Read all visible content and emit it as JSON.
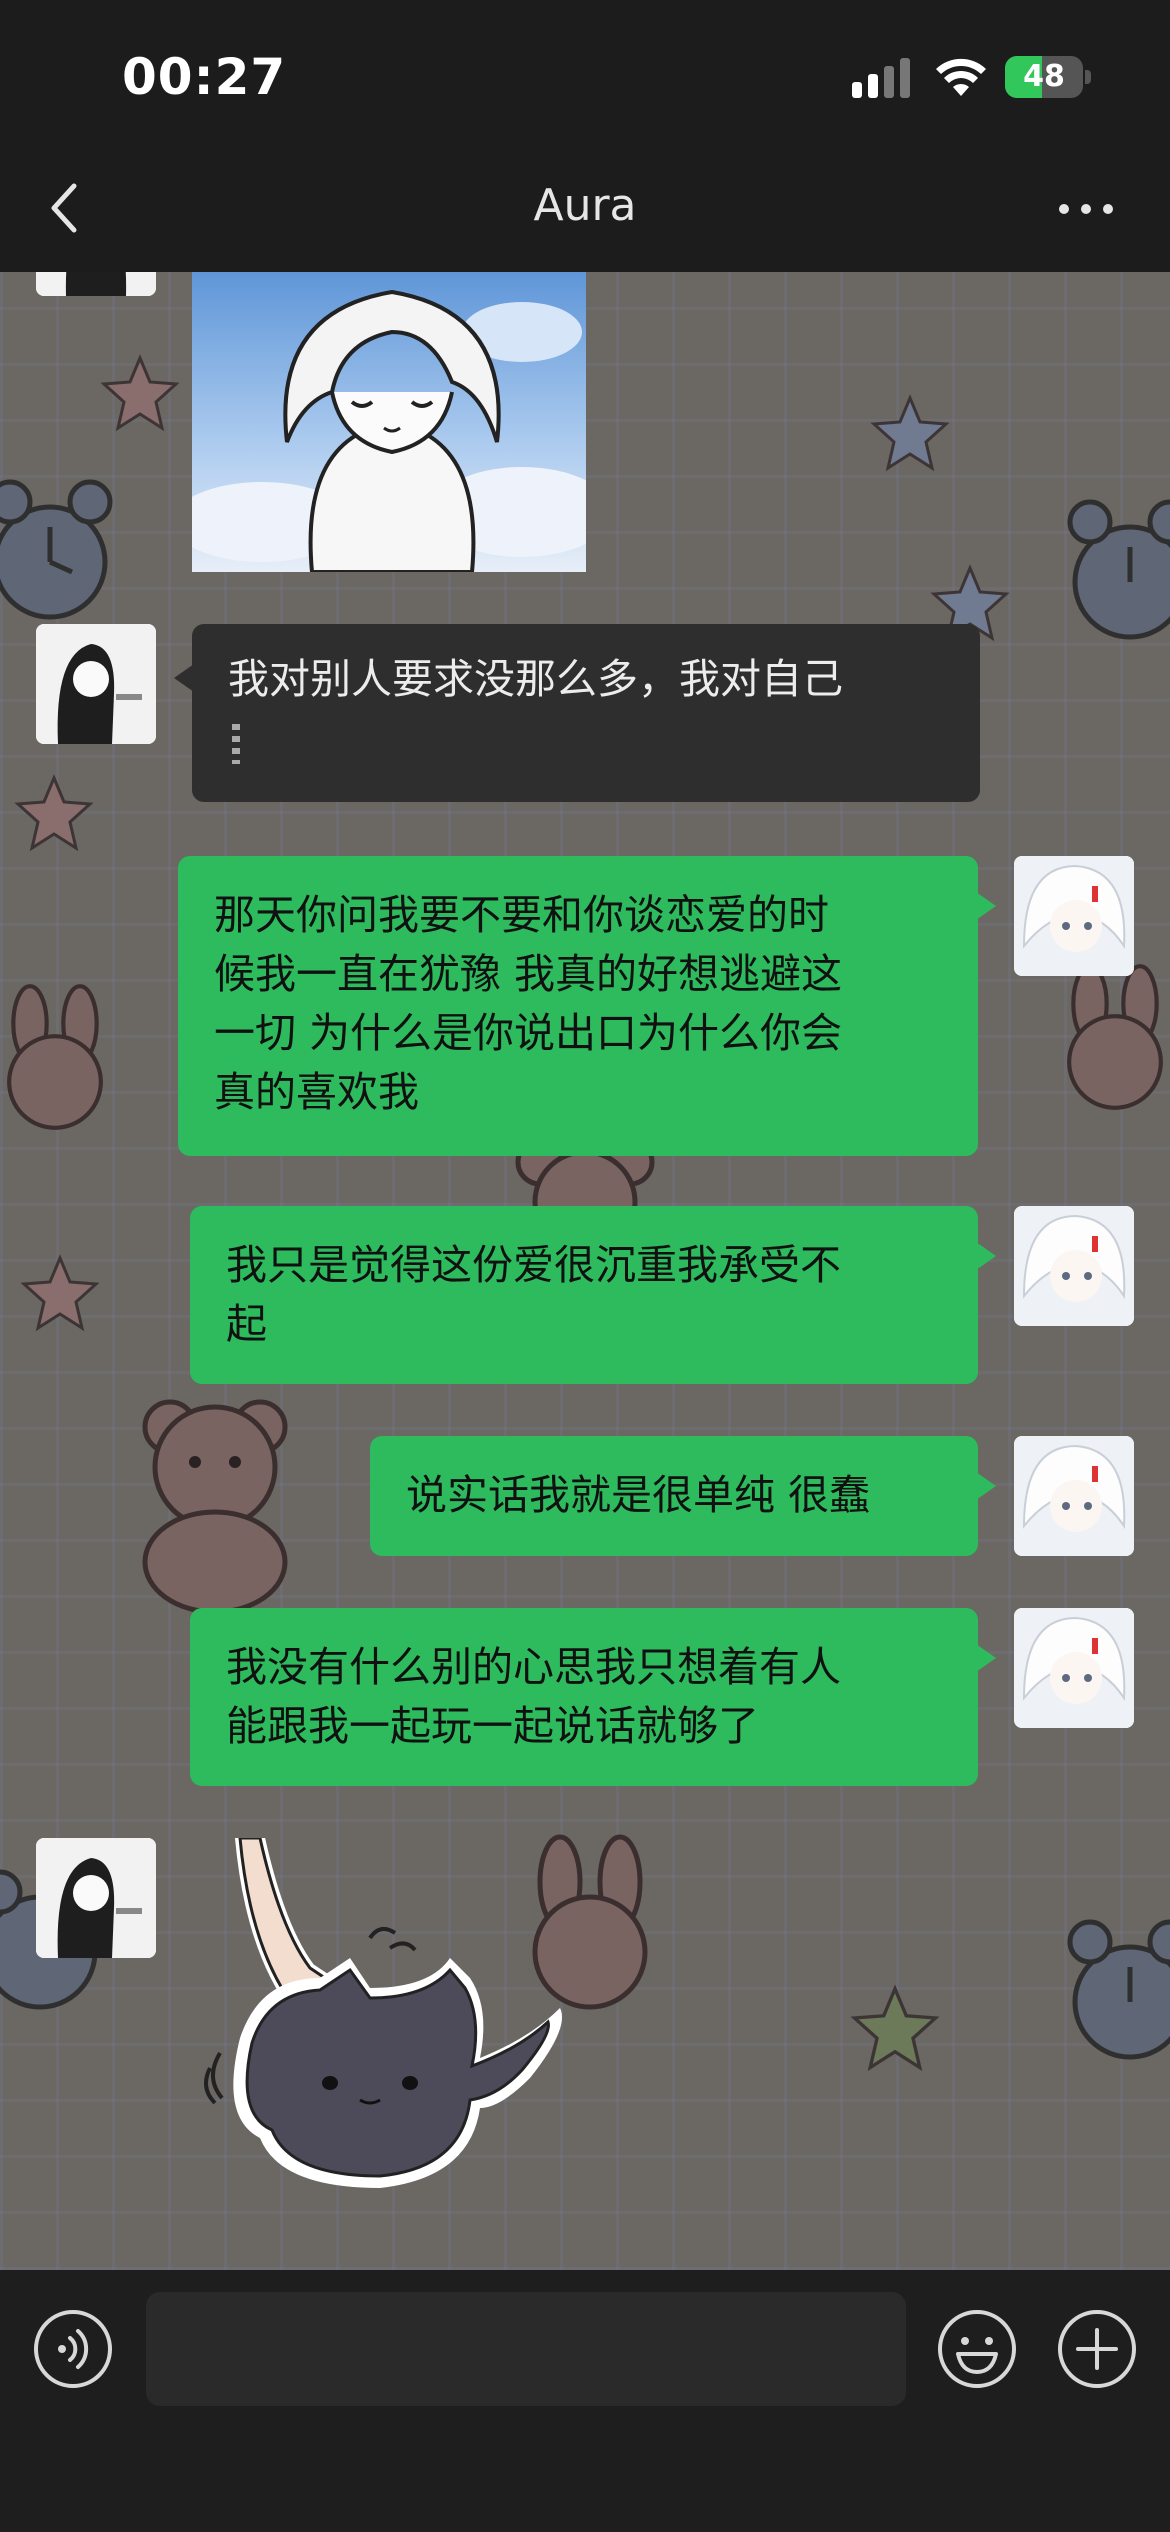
{
  "status_bar": {
    "time": "00:27",
    "battery_percent": 48,
    "battery_label": "48"
  },
  "header": {
    "title": "Aura",
    "back_icon": "chevron-left-icon",
    "more_icon": "more-dots-icon"
  },
  "messages": [
    {
      "side": "left",
      "type": "image",
      "description_icon": "cartoon-sticker"
    },
    {
      "side": "left",
      "type": "text",
      "text": "我对别人要求没那么多，我对自己"
    },
    {
      "side": "right",
      "type": "text",
      "lines": [
        "那天你问我要不要和你谈恋爱的时",
        "候我一直在犹豫 我真的好想逃避这",
        "一切 为什么是你说出口为什么你会",
        "真的喜欢我"
      ]
    },
    {
      "side": "right",
      "type": "text",
      "lines": [
        "我只是觉得这份爱很沉重我承受不",
        "起"
      ]
    },
    {
      "side": "right",
      "type": "text",
      "lines": [
        "说实话我就是很单纯 很蠢"
      ]
    },
    {
      "side": "right",
      "type": "text",
      "lines": [
        "我没有什么别的心思我只想着有人",
        "能跟我一起玩一起说话就够了"
      ]
    },
    {
      "side": "left",
      "type": "sticker",
      "description_icon": "cat-pat-sticker"
    }
  ],
  "input_bar": {
    "placeholder": "",
    "voice_icon": "voice-icon",
    "emoji_icon": "emoji-icon",
    "plus_icon": "plus-icon"
  },
  "colors": {
    "bubble_green": "#2dbb5e",
    "bubble_dark": "#2e2e2e",
    "bar_bg": "#1c1c1c"
  }
}
